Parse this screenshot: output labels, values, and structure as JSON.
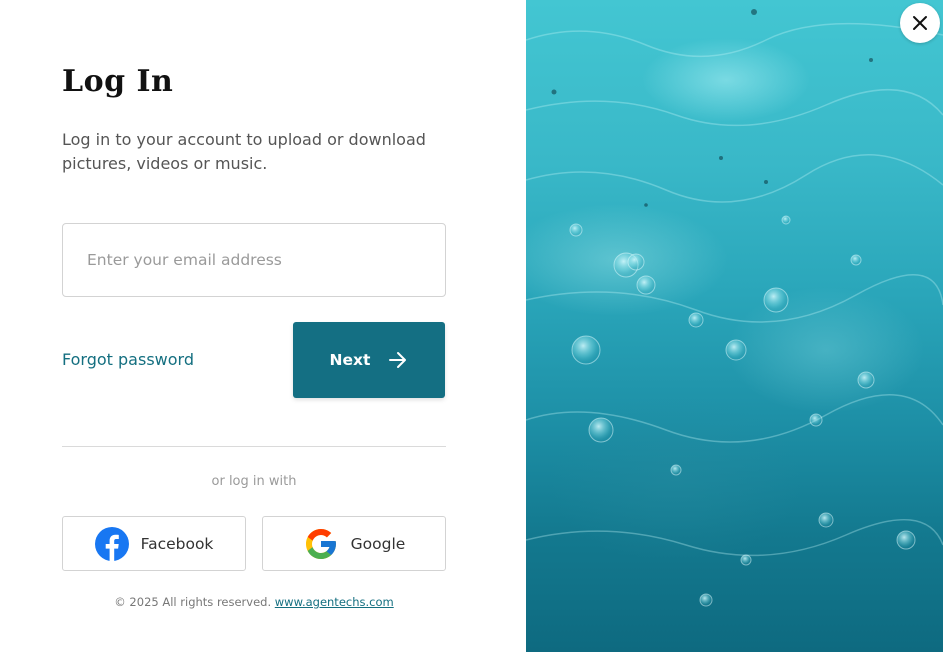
{
  "login": {
    "title": "Log In",
    "subtitle": "Log in to your account to upload or download pictures, videos or music.",
    "email_placeholder": "Enter your email address",
    "email_value": "",
    "forgot_label": "Forgot password",
    "next_label": "Next",
    "divider_text": "or log in with",
    "facebook_label": "Facebook",
    "google_label": "Google",
    "footer_text": "© 2025 All rights reserved.",
    "footer_link": "www.agentechs.com"
  },
  "colors": {
    "accent": "#146f83",
    "link": "#146f80",
    "facebook": "#1877f2"
  },
  "icons": {
    "close": "close-icon",
    "next_arrow": "arrow-right-icon",
    "facebook": "facebook-icon",
    "google": "google-icon"
  }
}
